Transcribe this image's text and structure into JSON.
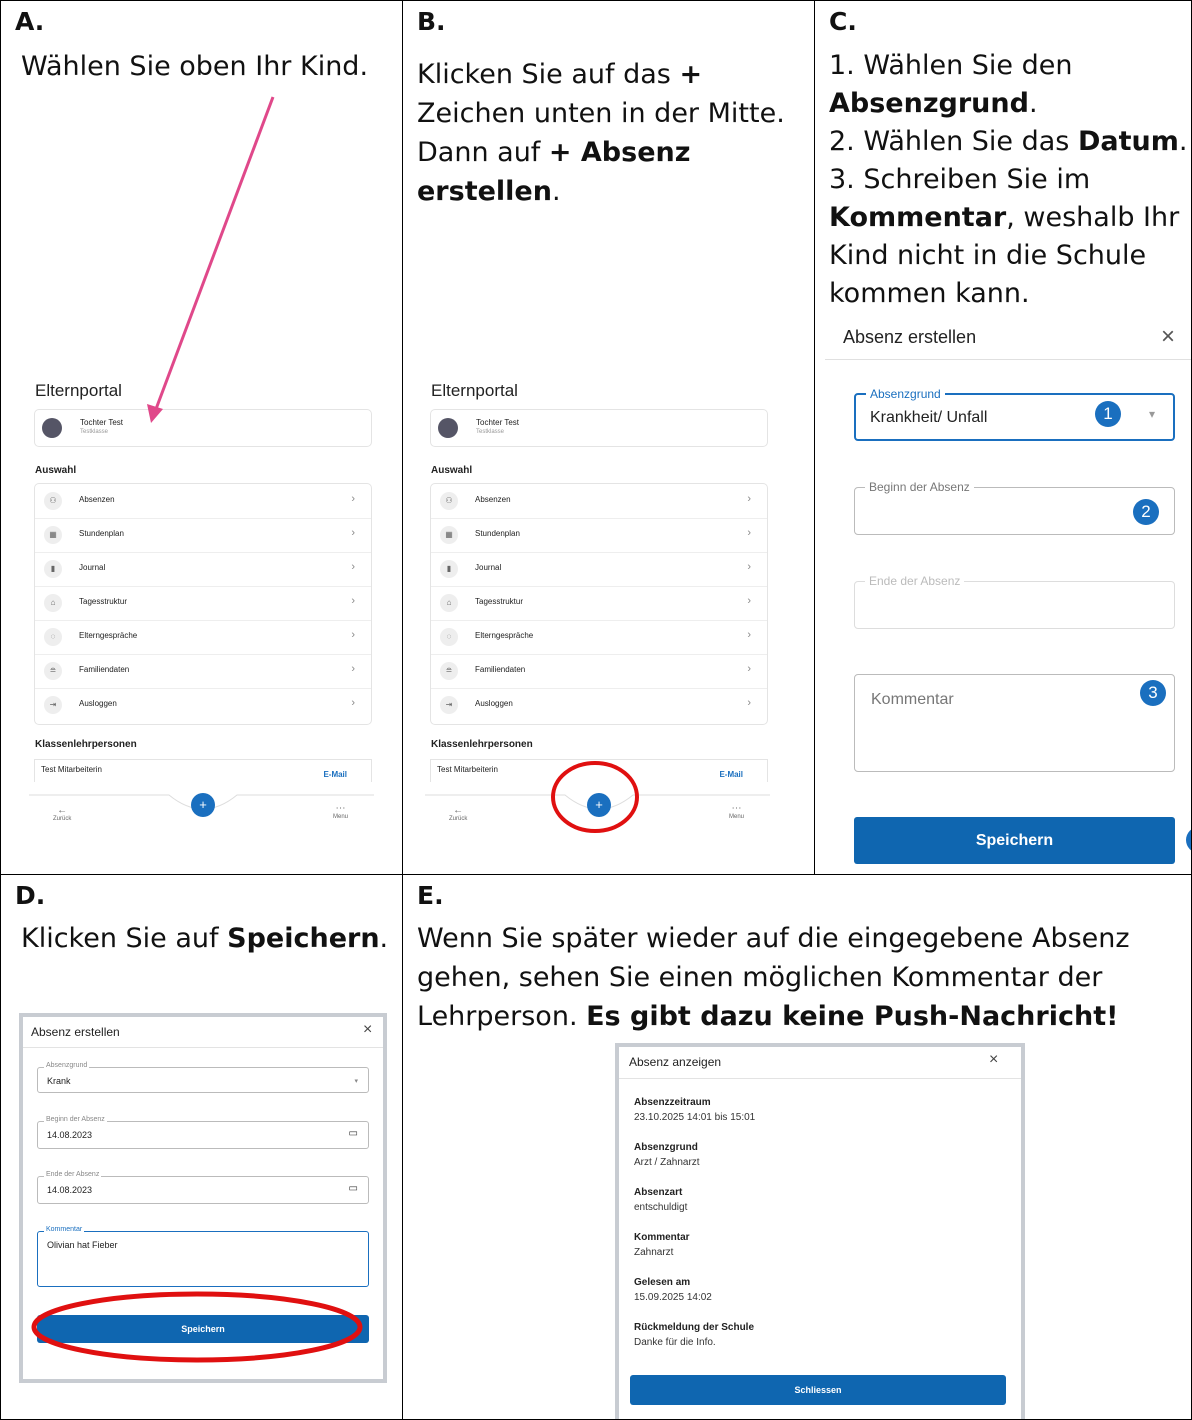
{
  "panels": {
    "a": {
      "label": "A.",
      "text": "Wählen Sie oben Ihr Kind."
    },
    "b": {
      "label": "B.",
      "line1": "Klicken Sie auf das ",
      "line1_bold": "+",
      "line2": "Zeichen unten in der Mitte.",
      "line3": "Dann auf ",
      "line3_bold": "+ Absenz",
      "line4_bold": "erstellen",
      "line4": "."
    },
    "c": {
      "label": "C.",
      "l1": "1. Wählen Sie den",
      "l2_bold": "Absenzgrund",
      "l2": ".",
      "l3": "2. Wählen Sie das ",
      "l3_bold": "Datum",
      "l3_end": ".",
      "l4": "3. Schreiben Sie im",
      "l5_bold": "Kommentar",
      "l5": ", weshalb Ihr",
      "l6": "Kind nicht in die Schule",
      "l7": "kommen kann."
    },
    "d": {
      "label": "D.",
      "text": "Klicken Sie auf ",
      "text_bold": "Speichern",
      "text_end": "."
    },
    "e": {
      "label": "E.",
      "l1": "Wenn Sie später wieder auf die eingegebene Absenz",
      "l2": "gehen, sehen Sie einen möglichen Kommentar der",
      "l3": "Lehrperson. ",
      "l3_bold": "Es gibt dazu keine Push-Nachricht!"
    }
  },
  "portal": {
    "title": "Elternportal",
    "child_name": "Tochter Test",
    "child_class": "Testklasse",
    "section_choice": "Auswahl",
    "menu": [
      {
        "label": "Absenzen",
        "icon": "person-clock-icon"
      },
      {
        "label": "Stundenplan",
        "icon": "calendar-icon"
      },
      {
        "label": "Journal",
        "icon": "book-icon"
      },
      {
        "label": "Tagesstruktur",
        "icon": "house-icon"
      },
      {
        "label": "Elterngespräche",
        "icon": "chat-icon"
      },
      {
        "label": "Familiendaten",
        "icon": "database-icon"
      },
      {
        "label": "Ausloggen",
        "icon": "logout-icon"
      }
    ],
    "section_teachers": "Klassenlehrpersonen",
    "teacher": "Test Mitarbeiterin",
    "email": "E-Mail",
    "back": "Zurück",
    "menu_label": "Menu",
    "fab": "+"
  },
  "form_c": {
    "title": "Absenz erstellen",
    "reason_legend": "Absenzgrund",
    "reason_value": "Krankheit/ Unfall",
    "begin_legend": "Beginn der Absenz",
    "end_legend": "Ende der Absenz",
    "comment_placeholder": "Kommentar",
    "save": "Speichern",
    "n1": "1",
    "n2": "2",
    "n3": "3"
  },
  "form_d": {
    "title": "Absenz erstellen",
    "reason_legend": "Absenzgrund",
    "reason_value": "Krank",
    "begin_legend": "Beginn der Absenz",
    "begin_value": "14.08.2023",
    "end_legend": "Ende der Absenz",
    "end_value": "14.08.2023",
    "comment_legend": "Kommentar",
    "comment_value": "Olivian hat Fieber",
    "save": "Speichern"
  },
  "dialog_e": {
    "title": "Absenz anzeigen",
    "rows": [
      {
        "key": "Absenzzeitraum",
        "value": "23.10.2025 14:01 bis 15:01"
      },
      {
        "key": "Absenzgrund",
        "value": "Arzt / Zahnarzt"
      },
      {
        "key": "Absenzart",
        "value": "entschuldigt"
      },
      {
        "key": "Kommentar",
        "value": "Zahnarzt"
      },
      {
        "key": "Gelesen am",
        "value": "15.09.2025 14:02"
      },
      {
        "key": "Rückmeldung der Schule",
        "value": "Danke für die Info."
      }
    ],
    "close": "Schliessen"
  },
  "colors": {
    "accent": "#1a6fbf",
    "button": "#0f66b0",
    "arrow": "#e0488a",
    "highlight": "#e01010"
  }
}
